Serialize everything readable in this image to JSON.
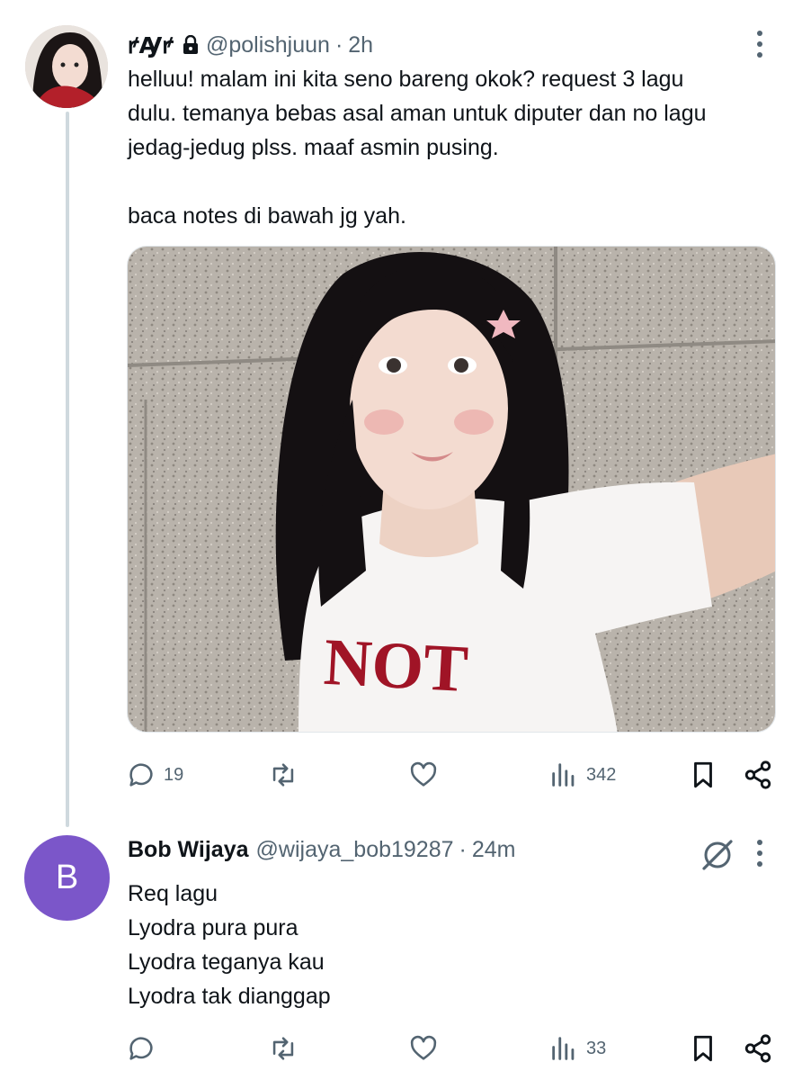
{
  "post": {
    "display_name": "ꝵꜼꝵ",
    "handle": "@polishjuun",
    "dot": "·",
    "time": "2h",
    "text": "helluu! malam ini kita seno bareng okok? request 3 lagu\ndulu. temanya bebas asal aman untuk diputer dan no lagu\njedag-jedug plss. maaf asmin pusing.\n\nbaca notes di bawah jg yah.",
    "replies": "19",
    "reposts": "",
    "likes": "",
    "views": "342"
  },
  "reply": {
    "avatar_letter": "B",
    "display_name": "Bob Wijaya",
    "handle": "@wijaya_bob19287",
    "dot": "·",
    "time": "24m",
    "text": "Req lagu\nLyodra pura pura\nLyodra teganya kau\nLyodra tak dianggap",
    "replies": "",
    "reposts": "",
    "likes": "",
    "views": "33"
  },
  "colors": {
    "text": "#0f1419",
    "secondary": "#536471",
    "avatar_bg": "#7b56c9",
    "thread_line": "#cfd9de"
  },
  "icons": [
    "more-icon",
    "lock-icon",
    "reply-icon",
    "repost-icon",
    "like-icon",
    "views-icon",
    "bookmark-icon",
    "share-icon",
    "grok-icon"
  ]
}
